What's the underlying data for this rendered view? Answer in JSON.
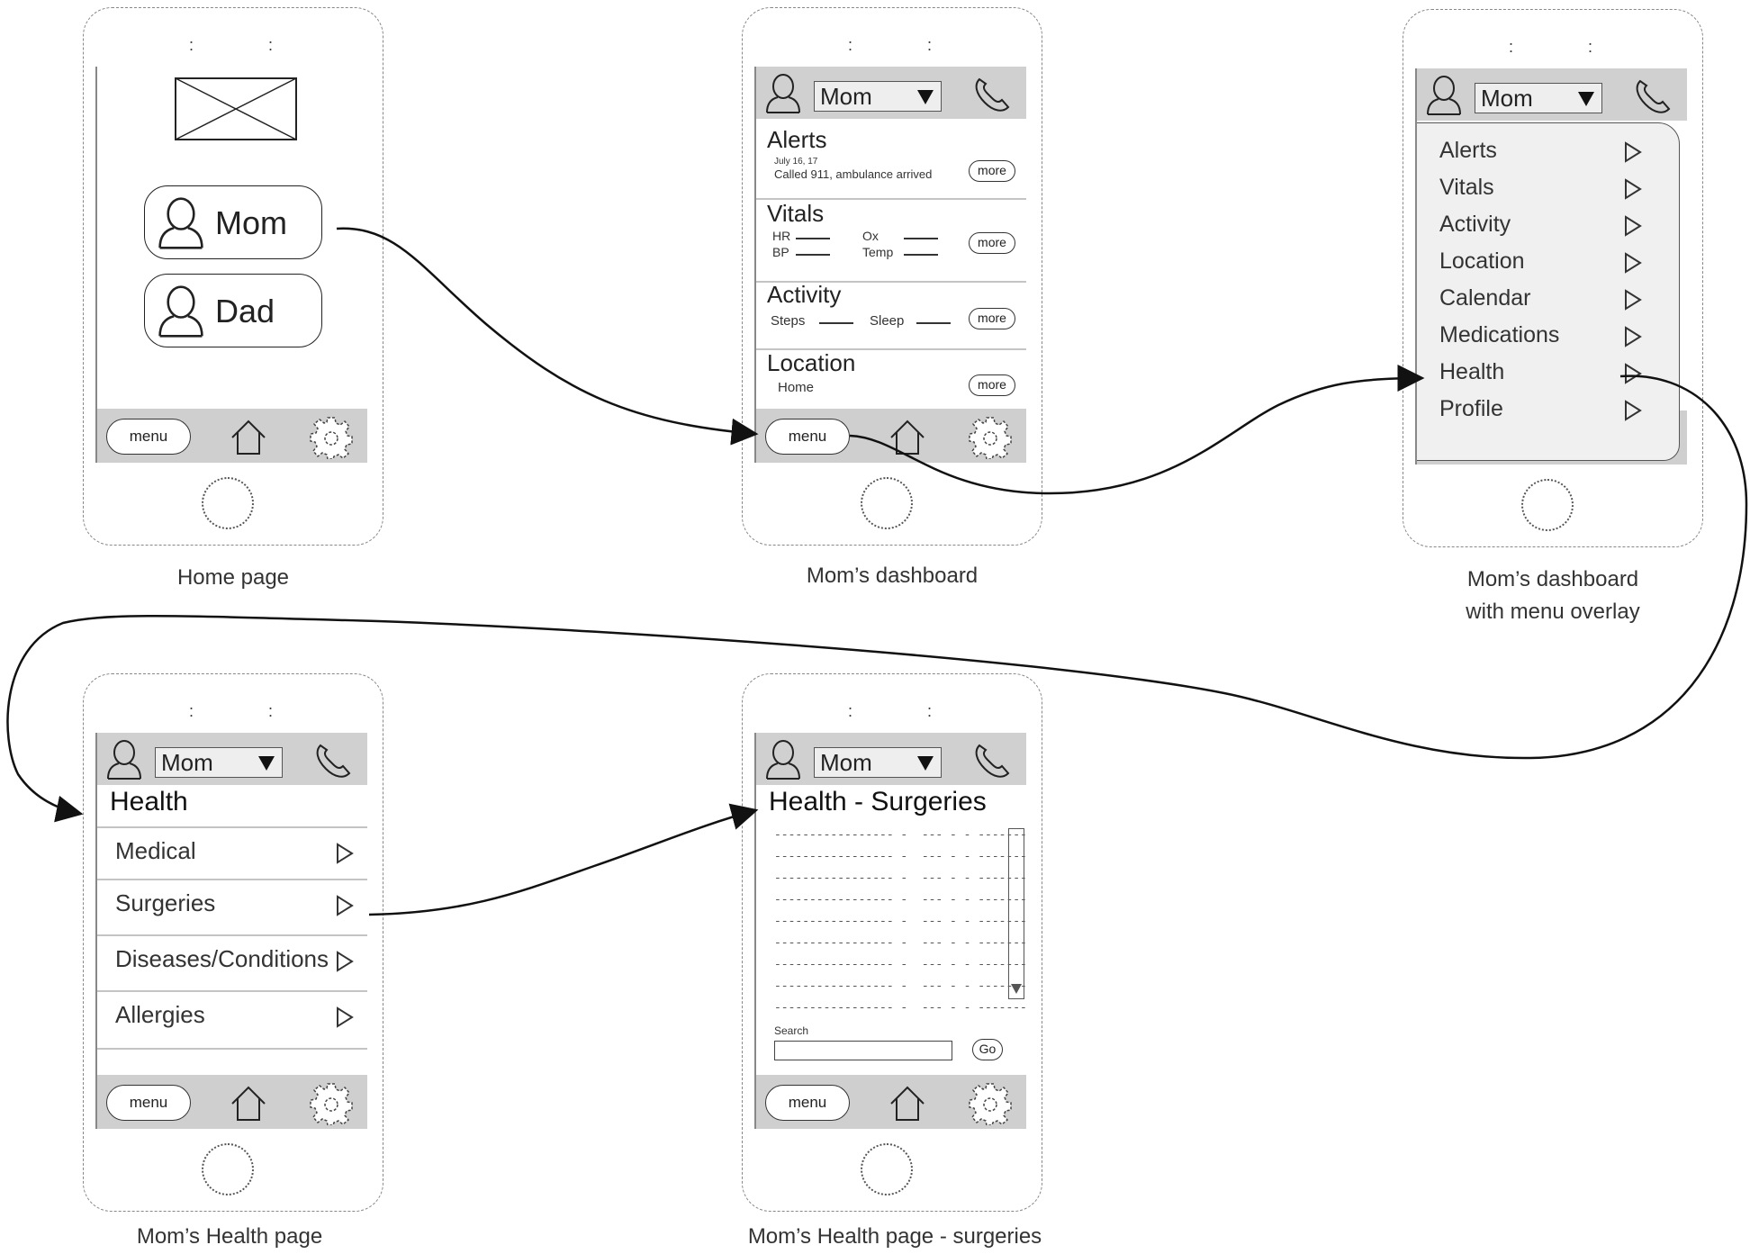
{
  "captions": {
    "home": "Home page",
    "dashboard": "Mom’s dashboard",
    "overlay_line1": "Mom’s dashboard",
    "overlay_line2": "with menu overlay",
    "health": "Mom’s Health page",
    "surgeries": "Mom’s Health page - surgeries"
  },
  "common": {
    "selected_person": "Mom",
    "menu_label": "menu",
    "more_label": "more",
    "speaker_dot": ":"
  },
  "home_page": {
    "people": [
      "Mom",
      "Dad"
    ]
  },
  "dashboard": {
    "alerts": {
      "title": "Alerts",
      "date": "July 16, 17",
      "text": "Called 911, ambulance arrived"
    },
    "vitals": {
      "title": "Vitals",
      "hr": "HR",
      "bp": "BP",
      "ox": "Ox",
      "temp": "Temp"
    },
    "activity": {
      "title": "Activity",
      "steps": "Steps",
      "sleep": "Sleep"
    },
    "location": {
      "title": "Location",
      "value": "Home"
    }
  },
  "overlay_menu": {
    "items": [
      "Alerts",
      "Vitals",
      "Activity",
      "Location",
      "Calendar",
      "Medications",
      "Health",
      "Profile"
    ]
  },
  "health_page": {
    "title": "Health",
    "items": [
      "Medical",
      "Surgeries",
      "Diseases/Conditions",
      "Allergies"
    ]
  },
  "surgeries_page": {
    "title": "Health - Surgeries",
    "row_text": "----------------- -  --- - - -------",
    "search_label": "Search",
    "go_label": "Go"
  }
}
